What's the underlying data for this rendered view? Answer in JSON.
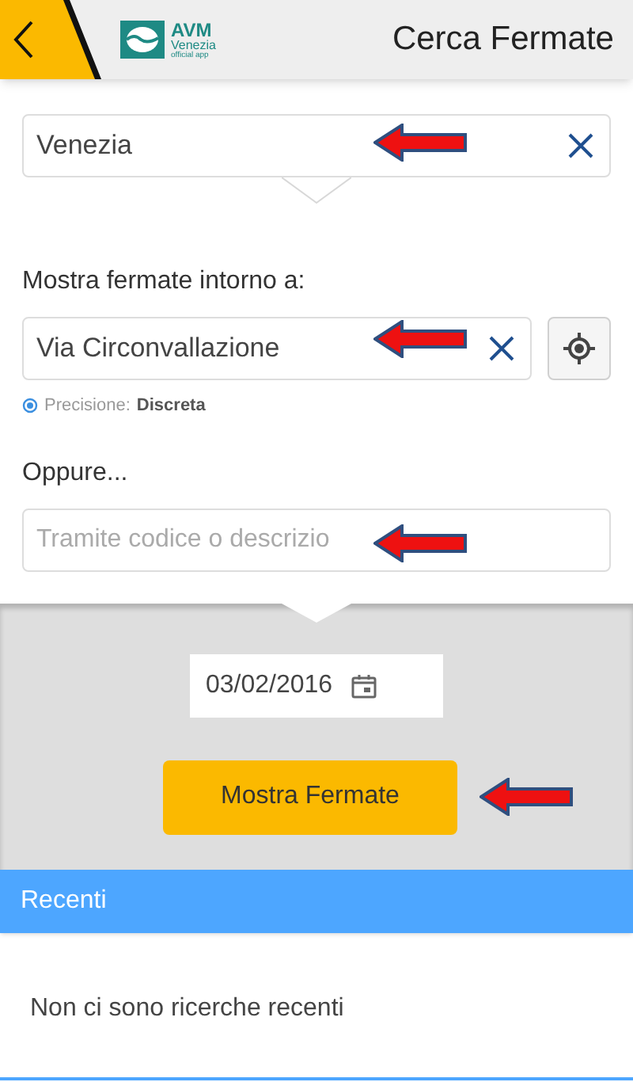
{
  "header": {
    "logo": {
      "name": "AVM",
      "city": "Venezia",
      "tagline": "official app"
    },
    "title": "Cerca Fermate"
  },
  "city_field": {
    "value": "Venezia"
  },
  "nearby": {
    "label": "Mostra fermate intorno a:",
    "value": "Via Circonvallazione",
    "precision_label": "Precisione:",
    "precision_value": "Discreta"
  },
  "alternative": {
    "label": "Oppure...",
    "placeholder": "Tramite codice o descrizio"
  },
  "date": "03/02/2016",
  "submit_button": "Mostra Fermate",
  "recent": {
    "title": "Recenti",
    "empty_message": "Non ci sono ricerche recenti"
  }
}
